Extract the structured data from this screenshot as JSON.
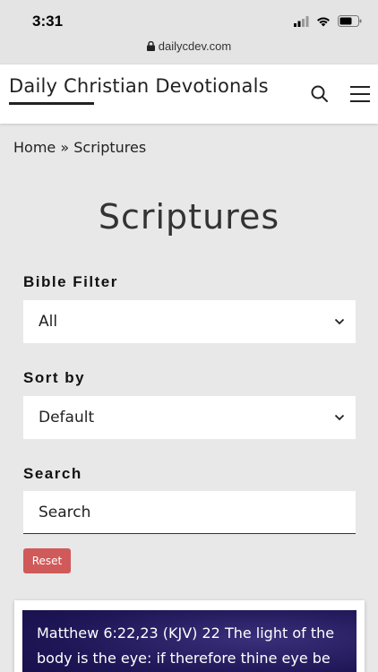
{
  "status_bar": {
    "time": "3:31",
    "url": "dailycdev.com"
  },
  "header": {
    "site_title": "Daily Christian Devotionals"
  },
  "breadcrumb": {
    "home": "Home",
    "separator": "»",
    "current": "Scriptures"
  },
  "page": {
    "title": "Scriptures"
  },
  "filters": {
    "bible_filter_label": "Bible Filter",
    "bible_filter_value": "All",
    "sort_label": "Sort by",
    "sort_value": "Default",
    "search_label": "Search",
    "search_placeholder": "Search",
    "reset_label": "Reset"
  },
  "card": {
    "text": "Matthew 6:22,23 (KJV) 22 The light of the body is the eye: if therefore thine eye be"
  },
  "colors": {
    "reset": "#d05a5a",
    "card_bg": "#1e1656"
  }
}
